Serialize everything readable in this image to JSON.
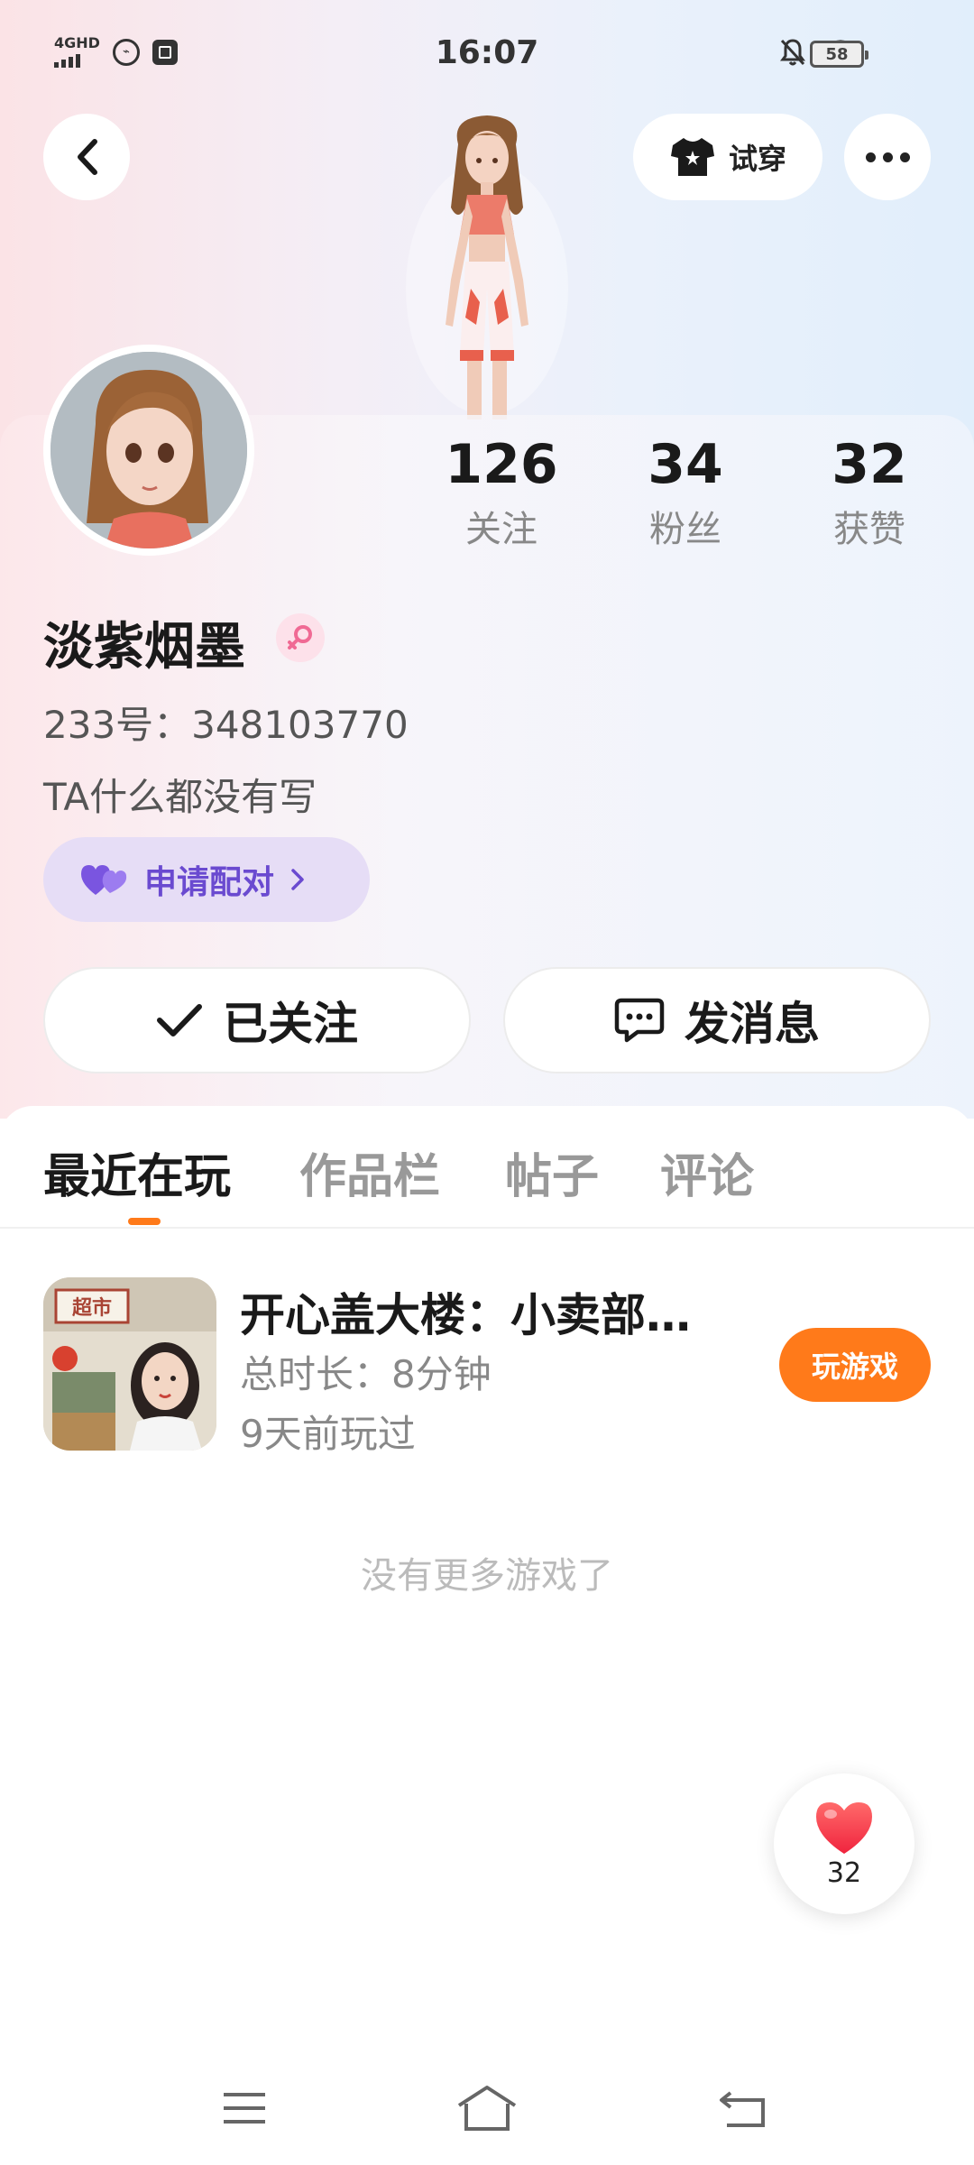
{
  "status_bar": {
    "network": "4GHD",
    "time": "16:07",
    "battery": "58"
  },
  "header": {
    "tryon_label": "试穿"
  },
  "profile": {
    "stats": [
      {
        "value": "126",
        "label": "关注"
      },
      {
        "value": "34",
        "label": "粉丝"
      },
      {
        "value": "32",
        "label": "获赞"
      }
    ],
    "name": "淡紫烟墨",
    "uid": "233号：348103770",
    "bio": "TA什么都没有写",
    "pair_label": "申请配对",
    "follow_label": "已关注",
    "message_label": "发消息"
  },
  "tabs": [
    {
      "label": "最近在玩",
      "active": true
    },
    {
      "label": "作品栏",
      "active": false
    },
    {
      "label": "帖子",
      "active": false
    },
    {
      "label": "评论",
      "active": false
    }
  ],
  "games": [
    {
      "title": "开心盖大楼：小卖部…",
      "duration": "总时长：8分钟",
      "last_played": "9天前玩过",
      "icon_sign": "超市",
      "play_label": "玩游戏"
    }
  ],
  "no_more_text": "没有更多游戏了",
  "like_float": {
    "count": "32"
  },
  "colors": {
    "accent": "#ff7a1a",
    "pair": "#6a4ad0",
    "pair_bg": "#e6ddf6"
  }
}
